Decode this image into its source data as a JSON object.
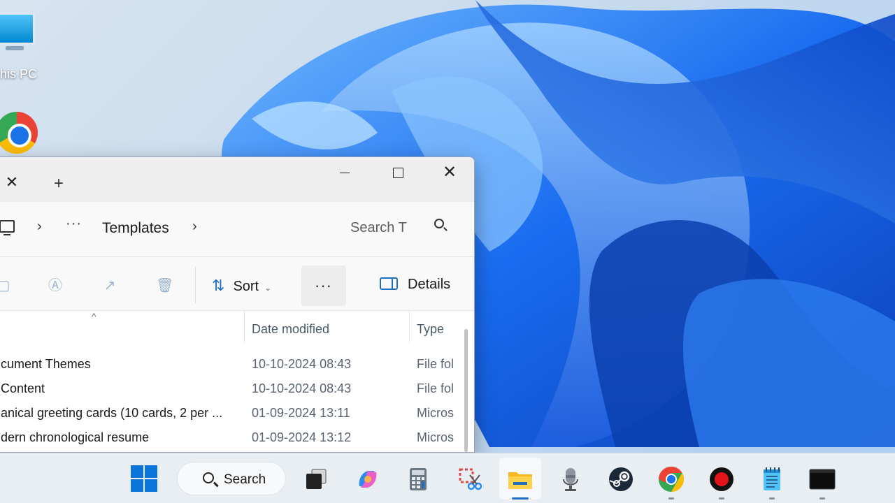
{
  "desktop": {
    "this_pc_label": "his PC"
  },
  "explorer": {
    "tab_close": "✕",
    "tab_add": "+",
    "window_close": "✕",
    "breadcrumb": {
      "overflow": "···",
      "current": "Templates",
      "separator": "›"
    },
    "search_placeholder": "Search T",
    "toolbar": {
      "sort_label": "Sort",
      "more_label": "···",
      "details_label": "Details"
    },
    "columns": {
      "date_modified": "Date modified",
      "type": "Type"
    },
    "files": [
      {
        "name": "cument Themes",
        "date": "10-10-2024 08:43",
        "type": "File fol"
      },
      {
        "name": "Content",
        "date": "10-10-2024 08:43",
        "type": "File fol"
      },
      {
        "name": "anical greeting cards (10 cards, 2 per ...",
        "date": "01-09-2024 13:11",
        "type": "Micros"
      },
      {
        "name": "dern chronological resume",
        "date": "01-09-2024 13:12",
        "type": "Micros"
      }
    ]
  },
  "taskbar": {
    "search_label": "Search",
    "apps": [
      "start-icon",
      "task-view-icon",
      "copilot-icon",
      "calculator-icon",
      "snipping-tool-icon",
      "file-explorer-icon",
      "microphone-icon",
      "steam-icon",
      "chrome-icon",
      "recorder-icon",
      "notepad-icon",
      "terminal-icon"
    ]
  },
  "colors": {
    "accent": "#1f6fbf",
    "wallpaper_blue": "#0a5ee0",
    "taskbar_bg": "#e9eef3"
  }
}
